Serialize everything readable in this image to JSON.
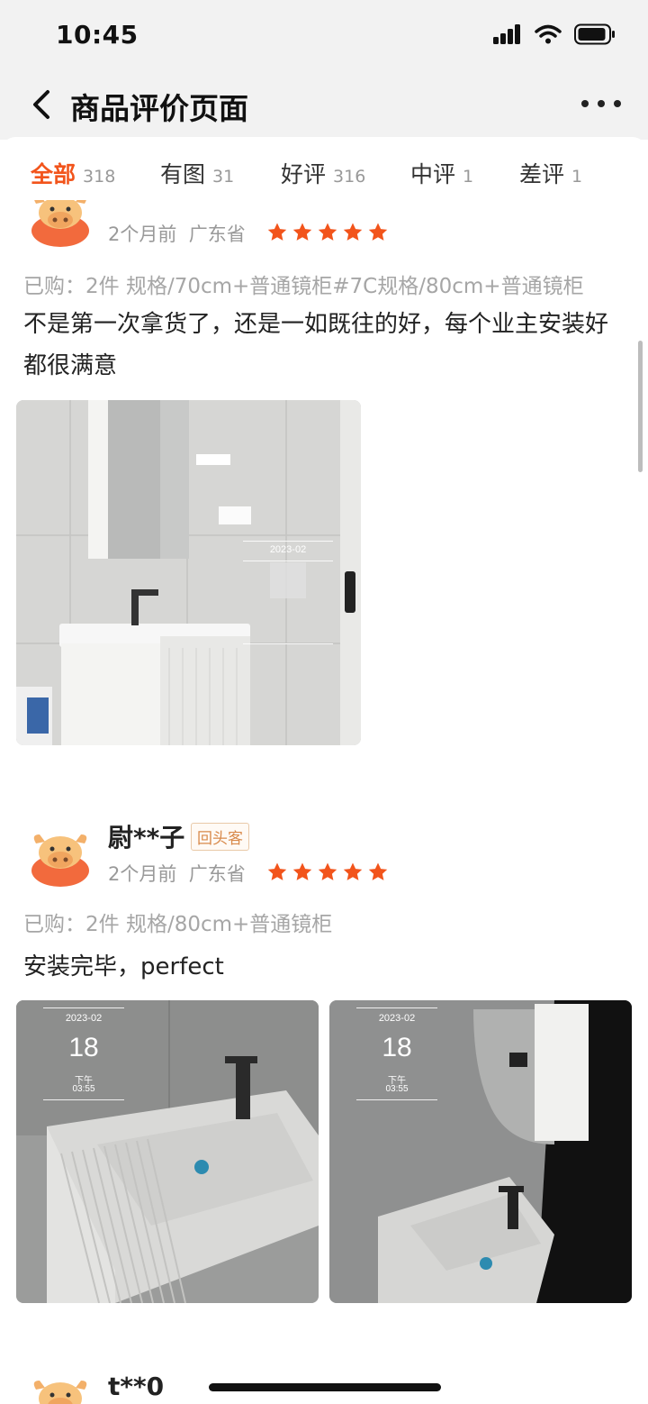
{
  "status_bar": {
    "time": "10:45"
  },
  "nav": {
    "title": "商品评价页面"
  },
  "tabs": [
    {
      "label": "全部",
      "count": "318",
      "active": true
    },
    {
      "label": "有图",
      "count": "31"
    },
    {
      "label": "好评",
      "count": "316"
    },
    {
      "label": "中评",
      "count": "1"
    },
    {
      "label": "差评",
      "count": "1"
    }
  ],
  "reviews": [
    {
      "time_ago": "2个月前",
      "location": "广东省",
      "rating": 5,
      "purchase": "已购：2件  规格/70cm+普通镜柜#7C规格/80cm+普通镜柜",
      "text": "不是第一次拿货了，还是一如既往的好，每个业主安装好都很满意",
      "photos": [
        {
          "watermark_date": "2023-02"
        }
      ]
    },
    {
      "username": "尉**子",
      "badge": "回头客",
      "time_ago": "2个月前",
      "location": "广东省",
      "rating": 5,
      "purchase": "已购：2件  规格/80cm+普通镜柜",
      "text": "安装完毕，perfect",
      "photos": [
        {
          "watermark_date": "2023-02",
          "watermark_day": "18",
          "watermark_period": "下午",
          "watermark_time": "03:55"
        },
        {
          "watermark_date": "2023-02",
          "watermark_day": "18",
          "watermark_period": "下午",
          "watermark_time": "03:55"
        }
      ]
    },
    {
      "username": "t**0"
    }
  ],
  "colors": {
    "accent": "#f2541b",
    "star": "#f2541b",
    "badge": "#d8894a"
  },
  "icons": {
    "back": "chevron-left-icon",
    "more": "more-dots-icon",
    "star": "star-icon",
    "avatar": "cow-avatar-icon"
  }
}
